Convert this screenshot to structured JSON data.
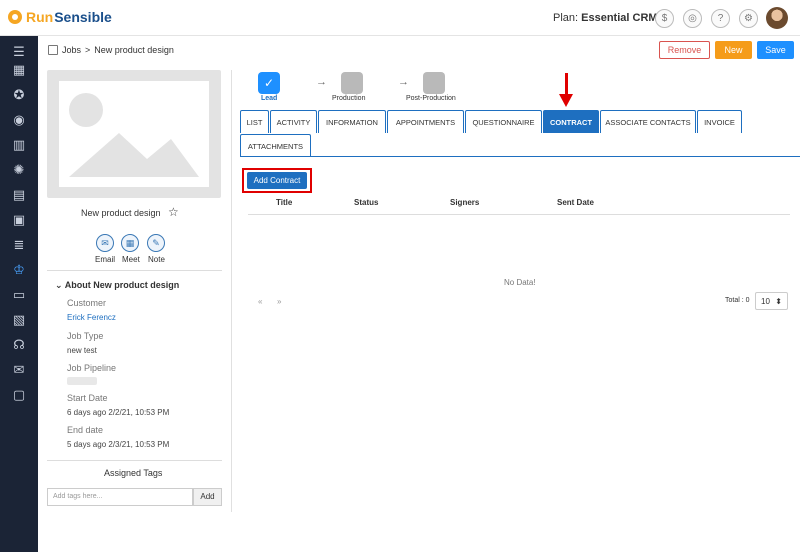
{
  "app": {
    "logo_run": "Run",
    "logo_sensible": "Sensible"
  },
  "header": {
    "plan_prefix": "Plan:",
    "plan_name": "Essential CRM"
  },
  "breadcrumb": {
    "section": "Jobs",
    "separator": ">",
    "current": "New product design"
  },
  "actions": {
    "remove": "Remove",
    "new": "New",
    "save": "Save"
  },
  "record": {
    "title": "New product design",
    "actions": [
      {
        "label": "Email",
        "icon": "email-icon"
      },
      {
        "label": "Meet",
        "icon": "calendar-icon"
      },
      {
        "label": "Note",
        "icon": "pencil-icon"
      }
    ],
    "about_title": "About New product design",
    "fields": {
      "customer_label": "Customer",
      "customer_value": "Erick Ferencz",
      "job_type_label": "Job Type",
      "job_type_value": "new test",
      "pipeline_label": "Job Pipeline",
      "start_label": "Start Date",
      "start_value": "6 days ago 2/2/21, 10:53 PM",
      "end_label": "End date",
      "end_value": "5 days ago 2/3/21, 10:53 PM"
    },
    "tags_title": "Assigned Tags",
    "tags_placeholder": "Add tags here...",
    "tags_add": "Add"
  },
  "pipeline": {
    "stages": [
      {
        "label": "Lead",
        "done": true
      },
      {
        "label": "Production",
        "done": false
      },
      {
        "label": "Post-Production",
        "done": false
      }
    ]
  },
  "tabs": [
    {
      "label": "LIST"
    },
    {
      "label": "ACTIVITY"
    },
    {
      "label": "INFORMATION"
    },
    {
      "label": "APPOINTMENTS"
    },
    {
      "label": "QUESTIONNAIRE"
    },
    {
      "label": "CONTRACT",
      "active": true
    },
    {
      "label": "ASSOCIATE CONTACTS"
    },
    {
      "label": "INVOICE"
    },
    {
      "label": "ATTACHMENTS"
    }
  ],
  "contract": {
    "add_button": "Add Contract",
    "columns": [
      "Title",
      "Status",
      "Signers",
      "Sent Date"
    ],
    "empty_text": "No Data!",
    "pager_prev": "«",
    "pager_next": "»",
    "total_text": "Total : 0",
    "page_size": "10"
  },
  "colors": {
    "accent": "#1e6fc0",
    "highlight": "#e00000",
    "new_button": "#f59c1a",
    "save_button": "#1e90ff",
    "sidebar": "#1b2436"
  }
}
